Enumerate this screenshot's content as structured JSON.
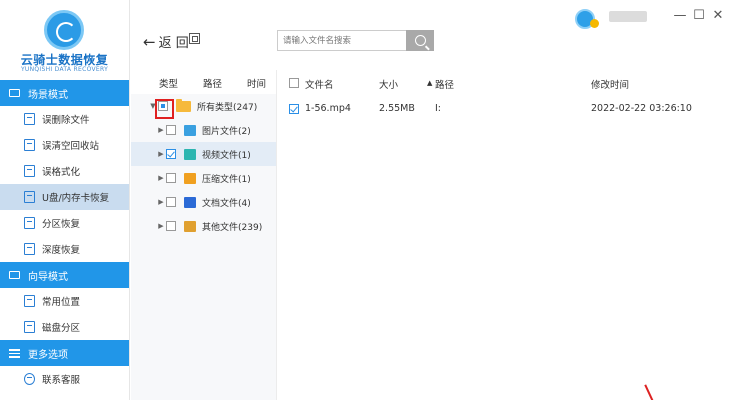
{
  "app": {
    "title": "云骑士数据恢复",
    "subtitle": "YUNQISHI DATA RECOVERY"
  },
  "sidebar": {
    "sections": [
      {
        "label": "场景模式",
        "items": [
          {
            "label": "误删除文件"
          },
          {
            "label": "误清空回收站"
          },
          {
            "label": "误格式化"
          },
          {
            "label": "U盘/内存卡恢复",
            "active": true
          },
          {
            "label": "分区恢复"
          },
          {
            "label": "深度恢复"
          }
        ]
      },
      {
        "label": "向导模式",
        "items": [
          {
            "label": "常用位置"
          },
          {
            "label": "磁盘分区"
          }
        ]
      },
      {
        "label": "更多选项",
        "items": [
          {
            "label": "联系客服"
          }
        ]
      }
    ]
  },
  "toolbar": {
    "back_label": "返 回",
    "search_placeholder": "请输入文件名搜索"
  },
  "window": {
    "minimize": "—",
    "maximize": "☐",
    "close": "✕"
  },
  "tree": {
    "headers": [
      "类型",
      "路径",
      "时间"
    ],
    "root": {
      "label": "所有类型(247)",
      "state": "partial"
    },
    "children": [
      {
        "label": "图片文件(2)",
        "icon": "image-icon",
        "checked": false,
        "color": "#3aa0e0"
      },
      {
        "label": "视频文件(1)",
        "icon": "video-icon",
        "checked": true,
        "color": "#2bb5b0"
      },
      {
        "label": "压缩文件(1)",
        "icon": "archive-icon",
        "checked": false,
        "color": "#f0a020"
      },
      {
        "label": "文档文件(4)",
        "icon": "word-icon",
        "checked": false,
        "color": "#2b6ad6"
      },
      {
        "label": "其他文件(239)",
        "icon": "other-icon",
        "checked": false,
        "color": "#e0a030"
      }
    ]
  },
  "file_list": {
    "columns": {
      "name": "文件名",
      "size": "大小",
      "path": "路径",
      "mtime": "修改时间"
    },
    "rows": [
      {
        "name": "1-56.mp4",
        "size": "2.55MB",
        "path": "I:",
        "mtime": "2022-02-22 03:26:10",
        "checked": true
      }
    ]
  }
}
